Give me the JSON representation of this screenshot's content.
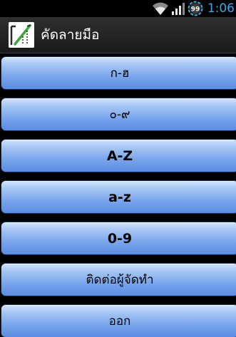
{
  "status_bar": {
    "battery_level": "99",
    "time": "1:06",
    "icons": [
      "wifi-icon",
      "signal-icon",
      "battery-icon"
    ],
    "clock_color": "#3aa8e6"
  },
  "title_bar": {
    "app_icon": "pen-writing-icon",
    "title": "คัดลายมือ"
  },
  "menu": {
    "items": [
      {
        "label": "ก-ฮ",
        "bold": false
      },
      {
        "label": "๐-๙",
        "bold": false
      },
      {
        "label": "A-Z",
        "bold": true
      },
      {
        "label": "a-z",
        "bold": true
      },
      {
        "label": "0-9",
        "bold": true
      },
      {
        "label": "ติดต่อผู้จัดทำ",
        "bold": false
      },
      {
        "label": "ออก",
        "bold": false
      }
    ],
    "button_color": "#7aa6ec"
  }
}
